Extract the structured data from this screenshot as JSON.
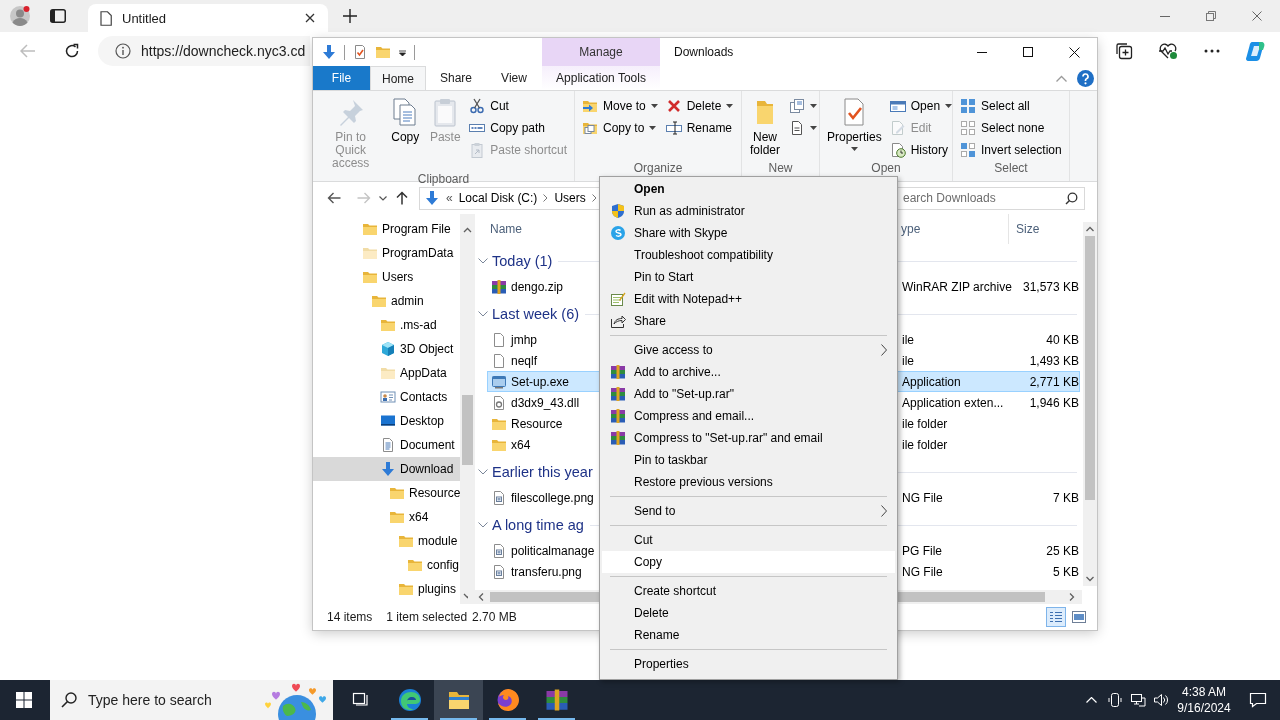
{
  "browser": {
    "tab": {
      "title": "Untitled"
    },
    "address": "https://downcheck.nyc3.cd"
  },
  "explorer": {
    "title": "Downloads",
    "context_group": "Manage",
    "tabs": [
      {
        "label": "File",
        "kind": "file",
        "selected": false
      },
      {
        "label": "Home",
        "kind": "normal",
        "selected": true
      },
      {
        "label": "Share",
        "kind": "normal",
        "selected": false
      },
      {
        "label": "View",
        "kind": "normal",
        "selected": false
      },
      {
        "label": "Application Tools",
        "kind": "context",
        "selected": false
      }
    ],
    "ribbon": [
      {
        "label": "Clipboard",
        "items": [
          {
            "kind": "large",
            "label": "Pin to Quick access",
            "disabled": true,
            "dropdown": false
          },
          {
            "kind": "large",
            "label": "Copy",
            "disabled": false,
            "dropdown": false
          },
          {
            "kind": "large",
            "label": "Paste",
            "disabled": true,
            "dropdown": false
          },
          {
            "kind": "stack",
            "items": [
              {
                "label": "Cut",
                "disabled": false,
                "dropdown": false
              },
              {
                "label": "Copy path",
                "disabled": false,
                "dropdown": false
              },
              {
                "label": "Paste shortcut",
                "disabled": true,
                "dropdown": false
              }
            ]
          }
        ]
      },
      {
        "label": "Organize",
        "items": [
          {
            "kind": "stack",
            "items": [
              {
                "label": "Move to",
                "disabled": false,
                "dropdown": true
              },
              {
                "label": "Copy to",
                "disabled": false,
                "dropdown": true
              }
            ]
          },
          {
            "kind": "stack",
            "items": [
              {
                "label": "Delete",
                "disabled": false,
                "dropdown": true
              },
              {
                "label": "Rename",
                "disabled": false,
                "dropdown": false
              }
            ]
          }
        ]
      },
      {
        "label": "New",
        "items": [
          {
            "kind": "large",
            "label": "New folder",
            "disabled": false,
            "dropdown": false
          },
          {
            "kind": "stack",
            "items": [
              {
                "disabled": false,
                "dropdown": true
              },
              {
                "disabled": false,
                "dropdown": true
              }
            ]
          }
        ]
      },
      {
        "label": "Open",
        "items": [
          {
            "kind": "large",
            "label": "Properties",
            "disabled": false,
            "dropdown": true
          },
          {
            "kind": "stack",
            "items": [
              {
                "label": "Open",
                "disabled": false,
                "dropdown": true
              },
              {
                "label": "Edit",
                "disabled": true,
                "dropdown": false
              },
              {
                "label": "History",
                "disabled": false,
                "dropdown": false
              }
            ]
          }
        ]
      },
      {
        "label": "Select",
        "items": [
          {
            "kind": "stack",
            "items": [
              {
                "label": "Select all",
                "disabled": false,
                "dropdown": false
              },
              {
                "label": "Select none",
                "disabled": false,
                "dropdown": false
              },
              {
                "label": "Invert selection",
                "disabled": false,
                "dropdown": false
              }
            ]
          }
        ]
      }
    ],
    "address": {
      "overflow": "«",
      "path": [
        "Local Disk (C:)",
        "Users"
      ]
    },
    "search_placeholder": "earch Downloads",
    "tree": [
      {
        "label": "Program File",
        "kind": "folder",
        "selected": false
      },
      {
        "label": "ProgramData",
        "kind": "hidden_folder",
        "selected": false
      },
      {
        "label": "Users",
        "kind": "folder",
        "selected": false,
        "children": [
          {
            "label": "admin",
            "kind": "folder",
            "selected": false,
            "children": [
              {
                "label": ".ms-ad",
                "kind": "folder",
                "selected": false
              },
              {
                "label": "3D Object",
                "kind": "objects",
                "selected": false
              },
              {
                "label": "AppData",
                "kind": "hidden_folder",
                "selected": false
              },
              {
                "label": "Contacts",
                "kind": "contacts",
                "selected": false
              },
              {
                "label": "Desktop",
                "kind": "desktop",
                "selected": false
              },
              {
                "label": "Document",
                "kind": "documents",
                "selected": false
              },
              {
                "label": "Download",
                "kind": "downloads",
                "selected": true,
                "children": [
                  {
                    "label": "Resource",
                    "kind": "folder",
                    "selected": false
                  },
                  {
                    "label": "x64",
                    "kind": "folder",
                    "selected": false,
                    "children": [
                      {
                        "label": "module",
                        "kind": "folder",
                        "selected": false,
                        "children": [
                          {
                            "label": "config",
                            "kind": "folder",
                            "selected": false
                          }
                        ]
                      },
                      {
                        "label": "plugins",
                        "kind": "folder",
                        "selected": false
                      }
                    ]
                  }
                ]
              }
            ]
          }
        ]
      }
    ],
    "columns": [
      "Name",
      "ype",
      "Size"
    ],
    "groups": [
      {
        "label": "Today (1)",
        "expanded": true,
        "rows": [
          {
            "name": "dengo.zip",
            "kind": "archive",
            "type": "WinRAR ZIP archive",
            "size": "31,573 KB",
            "selected": false
          }
        ]
      },
      {
        "label": "Last week (6)",
        "expanded": true,
        "rows": [
          {
            "name": "jmhp",
            "kind": "file",
            "type": "ile",
            "size": "40 KB",
            "selected": false
          },
          {
            "name": "neqlf",
            "kind": "file",
            "type": "ile",
            "size": "1,493 KB",
            "selected": false
          },
          {
            "name": "Set-up.exe",
            "kind": "program",
            "type": "Application",
            "size": "2,771 KB",
            "selected": true
          },
          {
            "name": "d3dx9_43.dll",
            "kind": "library",
            "type": "Application exten...",
            "size": "1,946 KB",
            "selected": false
          },
          {
            "name": "Resource",
            "kind": "folder",
            "type": "ile folder",
            "selected": false
          },
          {
            "name": "x64",
            "kind": "folder",
            "type": "ile folder",
            "selected": false
          }
        ]
      },
      {
        "label": "Earlier this year",
        "expanded": true,
        "rows": [
          {
            "name": "filescollege.png",
            "kind": "image",
            "type": "NG File",
            "size": "7 KB",
            "selected": false
          }
        ]
      },
      {
        "label": "A long time ag",
        "expanded": true,
        "rows": [
          {
            "name": "politicalmanage",
            "kind": "image",
            "type": "PG File",
            "size": "25 KB",
            "selected": false
          },
          {
            "name": "transferu.png",
            "kind": "image",
            "type": "NG File",
            "size": "5 KB",
            "selected": false
          }
        ]
      }
    ],
    "status": {
      "count": "14 items",
      "selection": "1 item selected",
      "size": "2.70 MB"
    },
    "views": [
      {
        "selected": true
      },
      {
        "selected": false
      }
    ]
  },
  "context_menu": [
    {
      "kind": "item",
      "label": "Open",
      "default": true,
      "submenu": false,
      "selected": false
    },
    {
      "kind": "item",
      "label": "Run as administrator",
      "default": false,
      "submenu": false,
      "selected": false
    },
    {
      "kind": "item",
      "label": "Share with Skype",
      "default": false,
      "submenu": false,
      "selected": false
    },
    {
      "kind": "item",
      "label": "Troubleshoot compatibility",
      "default": false,
      "submenu": false,
      "selected": false
    },
    {
      "kind": "item",
      "label": "Pin to Start",
      "default": false,
      "submenu": false,
      "selected": false
    },
    {
      "kind": "item",
      "label": "Edit with Notepad++",
      "default": false,
      "submenu": false,
      "selected": false
    },
    {
      "kind": "item",
      "label": "Share",
      "default": false,
      "submenu": false,
      "selected": false
    },
    {
      "kind": "separator"
    },
    {
      "kind": "item",
      "label": "Give access to",
      "default": false,
      "submenu": true,
      "selected": false
    },
    {
      "kind": "item",
      "label": "Add to archive...",
      "default": false,
      "submenu": false,
      "selected": false
    },
    {
      "kind": "item",
      "label": "Add to \"Set-up.rar\"",
      "default": false,
      "submenu": false,
      "selected": false
    },
    {
      "kind": "item",
      "label": "Compress and email...",
      "default": false,
      "submenu": false,
      "selected": false
    },
    {
      "kind": "item",
      "label": "Compress to \"Set-up.rar\" and email",
      "default": false,
      "submenu": false,
      "selected": false
    },
    {
      "kind": "item",
      "label": "Pin to taskbar",
      "default": false,
      "submenu": false,
      "selected": false
    },
    {
      "kind": "item",
      "label": "Restore previous versions",
      "default": false,
      "submenu": false,
      "selected": false
    },
    {
      "kind": "separator"
    },
    {
      "kind": "item",
      "label": "Send to",
      "default": false,
      "submenu": true,
      "selected": false
    },
    {
      "kind": "separator"
    },
    {
      "kind": "item",
      "label": "Cut",
      "default": false,
      "submenu": false,
      "selected": false
    },
    {
      "kind": "item",
      "label": "Copy",
      "default": false,
      "submenu": false,
      "selected": true
    },
    {
      "kind": "separator"
    },
    {
      "kind": "item",
      "label": "Create shortcut",
      "default": false,
      "submenu": false,
      "selected": false
    },
    {
      "kind": "item",
      "label": "Delete",
      "default": false,
      "submenu": false,
      "selected": false
    },
    {
      "kind": "item",
      "label": "Rename",
      "default": false,
      "submenu": false,
      "selected": false
    },
    {
      "kind": "separator"
    },
    {
      "kind": "item",
      "label": "Properties",
      "default": false,
      "submenu": false,
      "selected": false
    }
  ],
  "taskbar": {
    "search_placeholder": "Type here to search",
    "apps": [
      {
        "running": false,
        "active": false
      },
      {
        "running": true,
        "active": false
      },
      {
        "running": true,
        "active": true
      },
      {
        "running": true,
        "active": false
      },
      {
        "running": true,
        "active": false
      }
    ],
    "time": "4:38 AM",
    "date": "9/16/2024"
  }
}
